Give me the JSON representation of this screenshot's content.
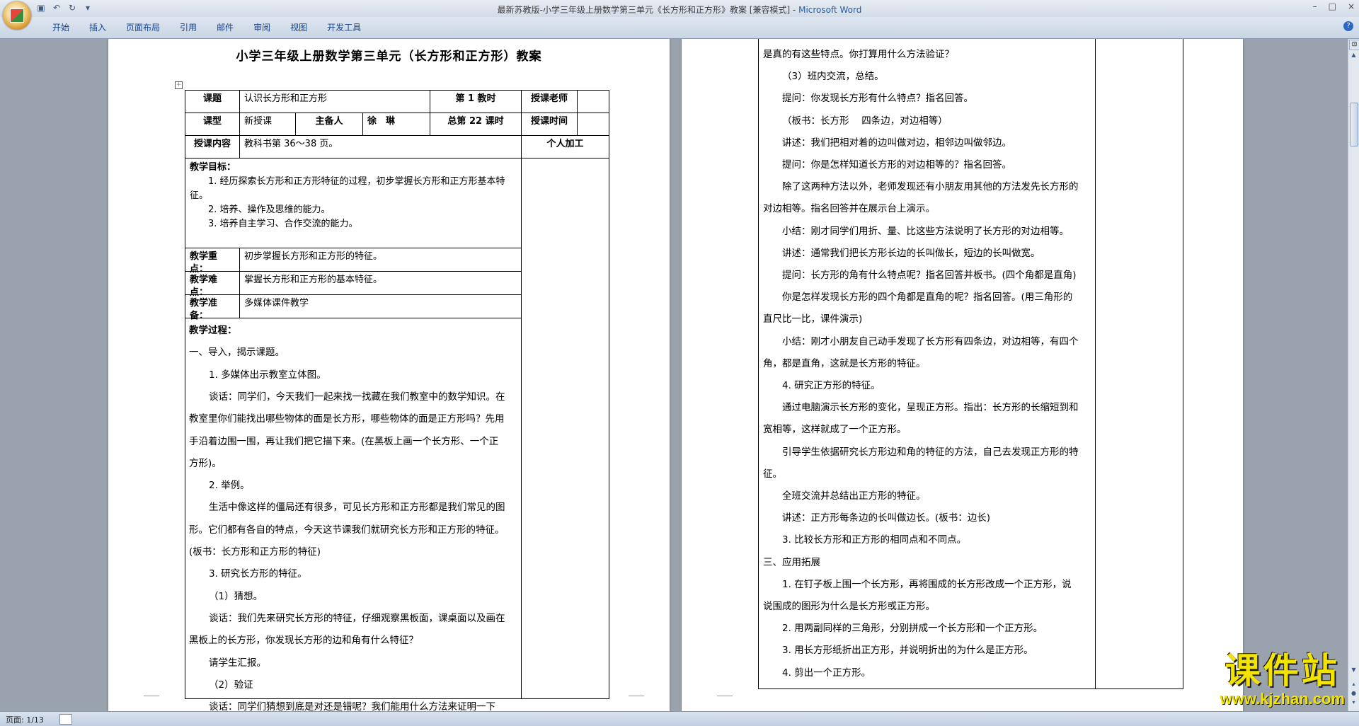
{
  "window": {
    "title": "最新苏教版-小学三年级上册数学第三单元《长方形和正方形》教案 [兼容模式] - ",
    "app": "Microsoft Word",
    "controls": [
      "–",
      "□",
      "×"
    ]
  },
  "quick_access": [
    "save-icon",
    "undo-icon",
    "redo-icon",
    "customize-icon"
  ],
  "ribbon": {
    "tabs": [
      "开始",
      "插入",
      "页面布局",
      "引用",
      "邮件",
      "审阅",
      "视图",
      "开发工具"
    ],
    "help": "?"
  },
  "status": {
    "page": "页面: 1/13"
  },
  "page1": {
    "title": "小学三年级上册数学第三单元（长方形和正方形）教案",
    "table": {
      "r1": {
        "l1": "课题",
        "v1": "认识长方形和正方形",
        "l2": "第 1 教时",
        "l3": "授课老师"
      },
      "r2": {
        "l1": "课型",
        "v1": "新授课",
        "l2": "主备人",
        "v2": "徐　琳",
        "l3": "总第 22 课时",
        "l4": "授课时间"
      },
      "r3": {
        "l1": "授课内容",
        "v1": "教科书第 36～38 页。",
        "l2": "个人加工"
      },
      "goals": {
        "head": "教学目标：",
        "items": [
          "1. 经历探索长方形和正方形特征的过程，初步掌握长方形和正方形基本特征。",
          "2. 培养、操作及思维的能力。",
          "3. 培养自主学习、合作交流的能力。"
        ]
      },
      "key": {
        "label": "教学重点：",
        "value": "初步掌握长方形和正方形的特征。"
      },
      "diff": {
        "label": "教学难点：",
        "value": "掌握长方形和正方形的基本特征。"
      },
      "prep": {
        "label": "教学准备：",
        "value": "多媒体课件教学"
      }
    },
    "process": [
      "教学过程：",
      "一、导入，揭示课题。",
      "1. 多媒体出示教室立体图。",
      "谈话：同学们，今天我们一起来找一找藏在我们教室中的数学知识。在",
      "教室里你们能找出哪些物体的面是长方形，哪些物体的面是正方形吗？先用",
      "手沿着边围一围，再让我们把它描下来。(在黑板上画一个长方形、一个正",
      "方形)。",
      "2. 举例。",
      "生活中像这样的僵局还有很多，可见长方形和正方形都是我们常见的图",
      "形。它们都有各自的特点，今天这节课我们就研究长方形和正方形的特征。",
      "(板书：长方形和正方形的特征)",
      "3. 研究长方形的特征。",
      "（1）猜想。",
      "谈话：我们先来研究长方形的特征，仔细观察黑板面，课桌面以及画在",
      "黑板上的长方形，你发现长方形的边和角有什么特征？",
      "请学生汇报。",
      "（2）验证",
      "谈话：同学们猜想到底是对还是错呢？我们能用什么方法来证明一下"
    ]
  },
  "page2": {
    "lines": [
      "是真的有这些特点。你打算用什么方法验证？",
      "（3）班内交流，总结。",
      "提问：你发现长方形有什么特点？指名回答。",
      "（板书：长方形　 四条边，对边相等）",
      "讲述：我们把相对着的边叫做对边，相邻边叫做邻边。",
      "提问：你是怎样知道长方形的对边相等的？指名回答。",
      "除了这两种方法以外，老师发现还有小朋友用其他的方法发先长方形的",
      "对边相等。指名回答并在展示台上演示。",
      "小结：刚才同学们用折、量、比这些方法说明了长方形的对边相等。",
      "讲述：通常我们把长方形长边的长叫做长，短边的长叫做宽。",
      "提问：长方形的角有什么特点呢？指名回答并板书。(四个角都是直角)",
      "你是怎样发现长方形的四个角都是直角的呢？指名回答。(用三角形的",
      "直尺比一比，课件演示)",
      "小结：刚才小朋友自己动手发现了长方形有四条边，对边相等，有四个",
      "角，都是直角，这就是长方形的特征。",
      "4. 研究正方形的特征。",
      "通过电脑演示长方形的变化，呈现正方形。指出：长方形的长缩短到和",
      "宽相等，这样就成了一个正方形。",
      "引导学生依据研究长方形边和角的特征的方法，自己去发现正方形的特",
      "征。",
      "全班交流并总结出正方形的特征。",
      "讲述：正方形每条边的长叫做边长。(板书：边长)",
      "3. 比较长方形和正方形的相同点和不同点。",
      "三、应用拓展",
      "1. 在钉子板上围一个长方形，再将围成的长方形改成一个正方形，说",
      "说围成的图形为什么是长方形或正方形。",
      "2. 用两副同样的三角形，分别拼成一个长方形和一个正方形。",
      "3. 用长方形纸折出正方形，并说明折出的为什么是正方形。",
      "4. 剪出一个正方形。"
    ]
  },
  "watermark": {
    "line1": "课件站",
    "line2": "www.kjzhan.com"
  }
}
